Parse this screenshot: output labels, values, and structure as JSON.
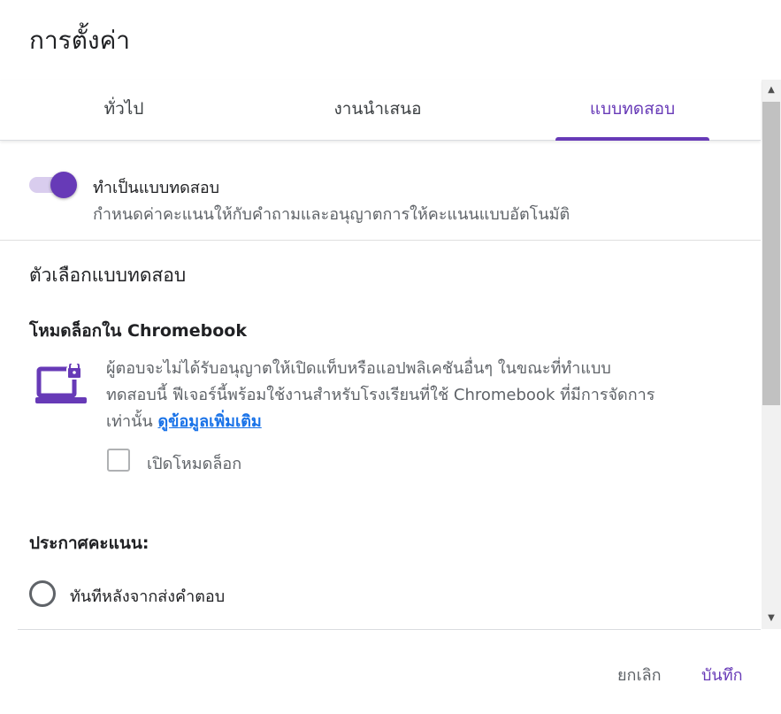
{
  "dialog": {
    "title": "การตั้งค่า"
  },
  "tabs": [
    {
      "label": "ทั่วไป",
      "active": false
    },
    {
      "label": "งานนำเสนอ",
      "active": false
    },
    {
      "label": "แบบทดสอบ",
      "active": true
    }
  ],
  "quiz_toggle": {
    "on": true,
    "title": "ทำเป็นแบบทดสอบ",
    "description": "กำหนดค่าคะแนนให้กับคำถามและอนุญาตการให้คะแนนแบบอัตโนมัติ"
  },
  "quiz_options": {
    "section_title": "ตัวเลือกแบบทดสอบ",
    "lock_mode": {
      "title": "โหมดล็อกใน Chromebook",
      "icon": "laptop-lock-icon",
      "description_line1": "ผู้ตอบจะไม่ได้รับอนุญาตให้เปิดแท็บหรือแอปพลิเคชันอื่นๆ ในขณะที่ทำแบบ",
      "description_line2": "ทดสอบนี้ ฟีเจอร์นี้พร้อมใช้งานสำหรับโรงเรียนที่ใช้ Chromebook ที่มีการจัดการ",
      "description_line3": "เท่านั้น",
      "learn_more": "ดูข้อมูลเพิ่มเติม",
      "checkbox_label": "เปิดโหมดล็อก",
      "checkbox_checked": false
    },
    "release_grade": {
      "title": "ประกาศคะแนน:",
      "option_label": "ทันทีหลังจากส่งคำตอบ"
    }
  },
  "actions": {
    "cancel": "ยกเลิก",
    "save": "บันทึก"
  },
  "colors": {
    "accent": "#673ab7",
    "link": "#1a73e8",
    "text_secondary": "#5f6368"
  }
}
